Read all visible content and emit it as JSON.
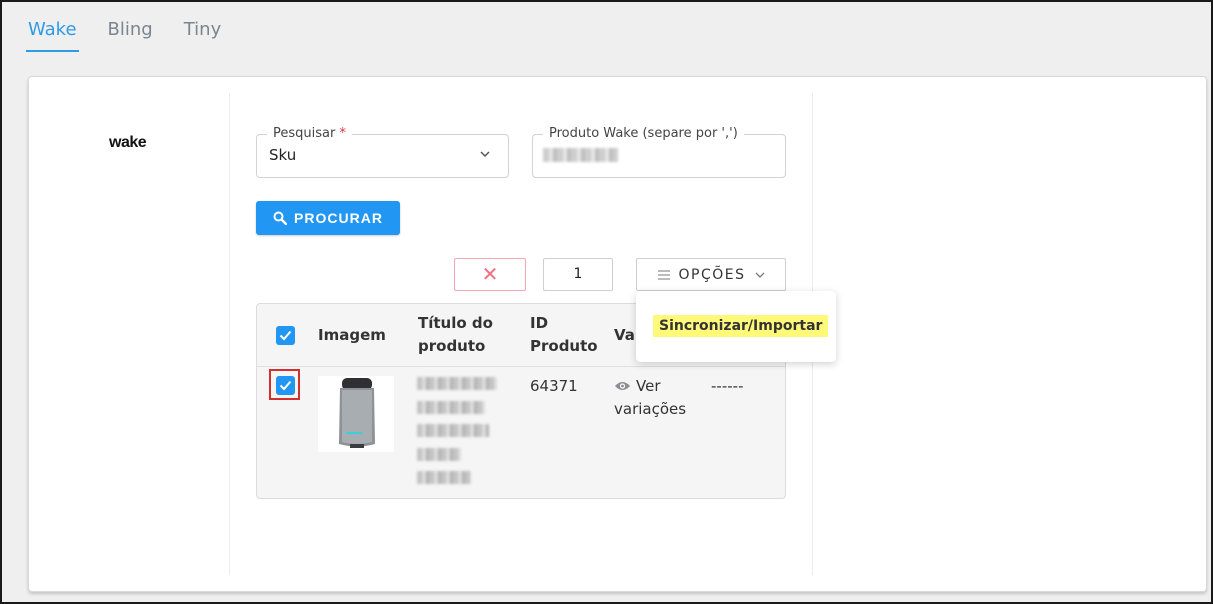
{
  "tabs": [
    {
      "label": "Wake",
      "active": true
    },
    {
      "label": "Bling",
      "active": false
    },
    {
      "label": "Tiny",
      "active": false
    }
  ],
  "logo": "wake",
  "search": {
    "label": "Pesquisar",
    "required_mark": "*",
    "value": "Sku"
  },
  "product_field": {
    "label": "Produto Wake (separe por ',')"
  },
  "search_button": {
    "label": "PROCURAR",
    "icon": "search-icon"
  },
  "toolbar": {
    "clear_icon": "✕",
    "page": "1",
    "options_label": "OPÇÕES"
  },
  "options_menu": {
    "items": [
      "Sincronizar/Importar"
    ],
    "highlight_color": "#fff97a"
  },
  "table": {
    "headers": {
      "image": "Imagem",
      "title_line1": "Título do",
      "title_line2": "produto",
      "id_line1": "ID",
      "id_line2": "Produto",
      "variations": "Va"
    },
    "rows": [
      {
        "id": "64371",
        "variations_line1": "Ver",
        "variations_line2": "variações",
        "extra": "------",
        "checked": true
      }
    ]
  },
  "colors": {
    "accent": "#2196f3",
    "tab_active": "#2f9be6",
    "danger": "#ef6f83"
  }
}
